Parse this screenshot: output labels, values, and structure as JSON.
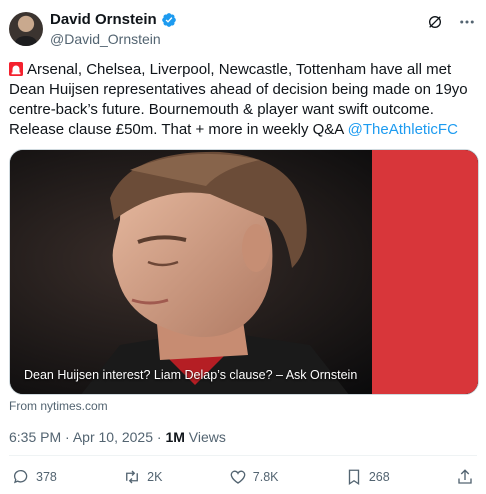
{
  "author": {
    "display_name": "David Ornstein",
    "handle": "@David_Ornstein"
  },
  "header_icons": [
    "grok-icon",
    "more-icon"
  ],
  "tweet": {
    "text_main": "Arsenal, Chelsea, Liverpool, Newcastle, Tottenham have all met Dean Huijsen representatives ahead of decision being made on 19yo centre-back’s future. Bournemouth & player want swift outcome. Release clause £50m. That + more in weekly Q&A",
    "mention": "@TheAthleticFC"
  },
  "media": {
    "caption": "Dean Huijsen interest? Liam Delap’s clause? – Ask Ornstein",
    "source": "From nytimes.com"
  },
  "meta": {
    "time": "6:35 PM",
    "date": "Apr 10, 2025",
    "views_count": "1M",
    "views_label": "Views"
  },
  "actions": {
    "replies": "378",
    "reposts": "2K",
    "likes": "7.8K",
    "bookmarks": "268"
  },
  "colors": {
    "accent": "#1d9bf0",
    "muted": "#536471",
    "verified": "#1d9bf0"
  }
}
